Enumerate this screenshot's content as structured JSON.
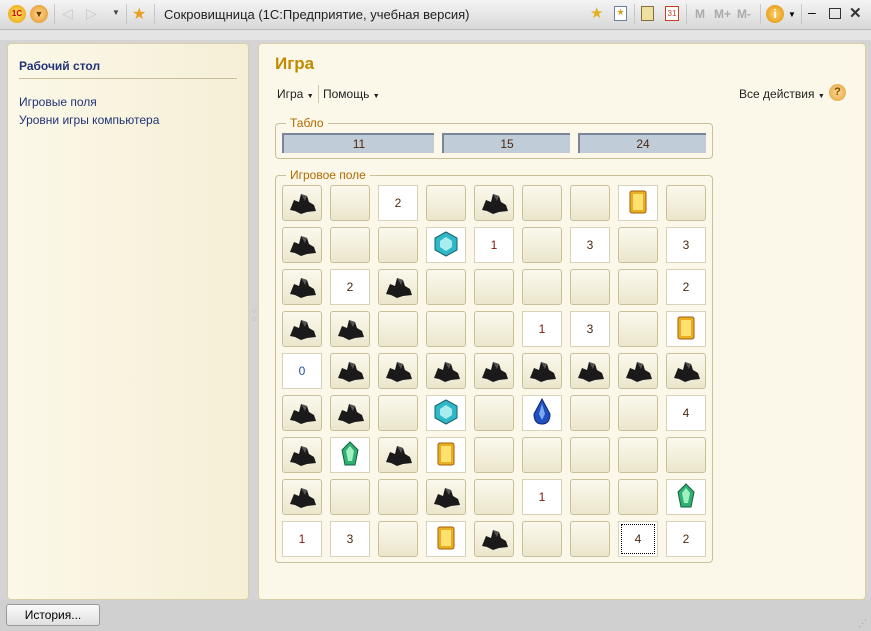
{
  "window": {
    "title": "Сокровищница  (1С:Предприятие, учебная версия)",
    "m": "M",
    "mplus": "M+",
    "mminus": "M-"
  },
  "sidebar": {
    "title": "Рабочий стол",
    "items": [
      "Игровые поля",
      "Уровни игры компьютера"
    ]
  },
  "main": {
    "title": "Игра",
    "menu_game": "Игра",
    "menu_help": "Помощь",
    "all_actions": "Все действия",
    "help_icon": "?"
  },
  "tablo": {
    "label": "Табло",
    "scores": [
      "11",
      "15",
      "24"
    ]
  },
  "field": {
    "label": "Игровое поле",
    "focused": [
      8,
      7
    ],
    "grid": [
      [
        "C",
        "",
        "2",
        "",
        "C",
        "",
        "",
        "Y",
        ""
      ],
      [
        "C",
        "",
        "",
        "T",
        "1",
        "",
        "3",
        "",
        "3"
      ],
      [
        "C",
        "2",
        "C",
        "",
        "",
        "",
        "",
        "",
        "2"
      ],
      [
        "C",
        "C",
        "",
        "",
        "",
        "1",
        "3",
        "",
        "Y"
      ],
      [
        "0",
        "C",
        "C",
        "C",
        "C",
        "C",
        "C",
        "C",
        "C"
      ],
      [
        "C",
        "C",
        "",
        "T",
        "",
        "B",
        "",
        "",
        "4"
      ],
      [
        "C",
        "G",
        "C",
        "Y",
        "",
        "",
        "",
        "",
        ""
      ],
      [
        "C",
        "",
        "",
        "C",
        "",
        "1",
        "",
        "",
        "G"
      ],
      [
        "1",
        "3",
        "",
        "Y",
        "C",
        "",
        "",
        "4",
        "2"
      ]
    ]
  },
  "footer": {
    "history": "История..."
  },
  "colors": {
    "accent": "#c08a00",
    "link": "#223377"
  }
}
